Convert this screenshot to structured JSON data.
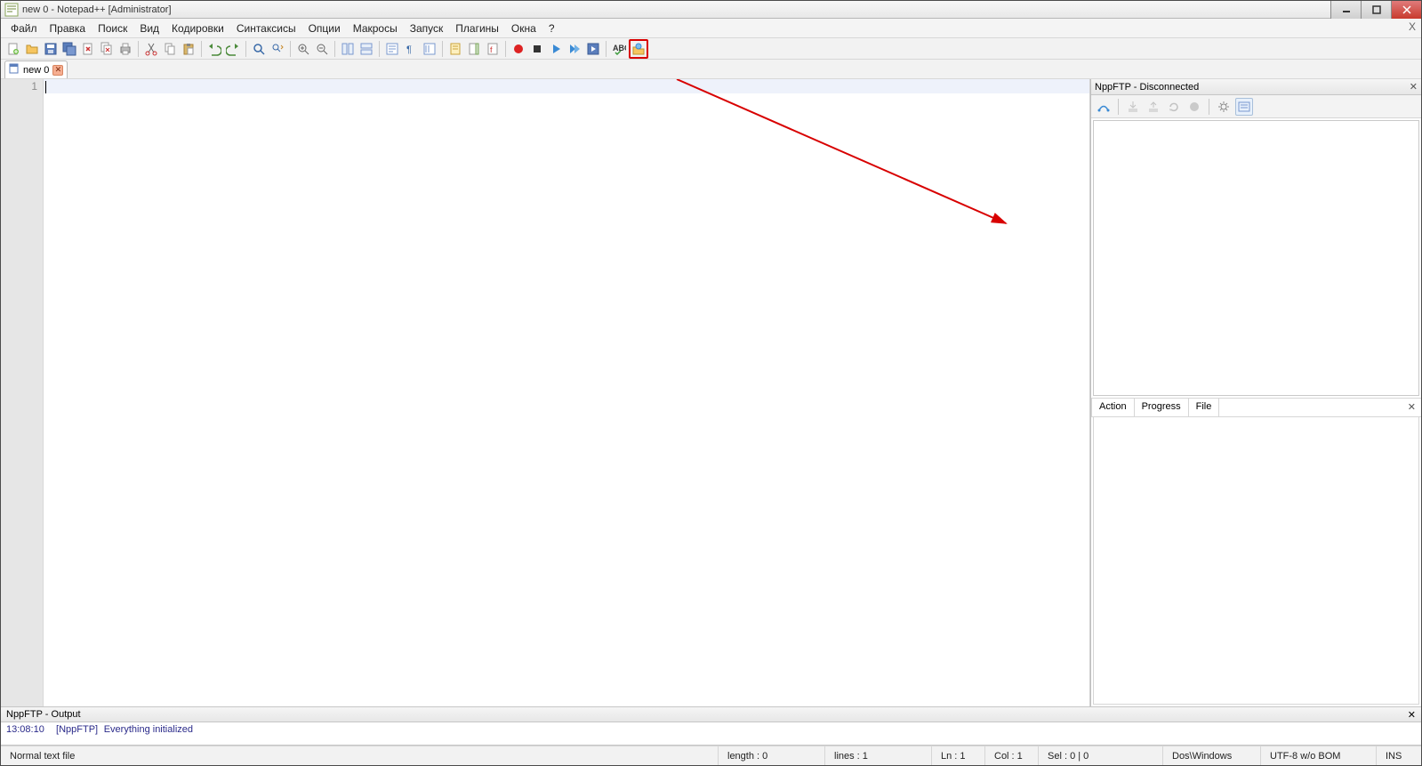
{
  "title": "new  0 - Notepad++ [Administrator]",
  "menu": [
    "Файл",
    "Правка",
    "Поиск",
    "Вид",
    "Кодировки",
    "Синтаксисы",
    "Опции",
    "Макросы",
    "Запуск",
    "Плагины",
    "Окна",
    "?"
  ],
  "tab": {
    "label": "new  0"
  },
  "gutter": {
    "line1": "1"
  },
  "rightpanel": {
    "title": "NppFTP - Disconnected",
    "tabs": [
      "Action",
      "Progress",
      "File"
    ]
  },
  "output": {
    "title": "NppFTP - Output",
    "timestamp": "13:08:10",
    "tag": "[NppFTP]",
    "msg": "Everything initialized"
  },
  "status": {
    "filetype": "Normal text file",
    "length": "length : 0",
    "lines": "lines : 1",
    "ln": "Ln : 1",
    "col": "Col : 1",
    "sel": "Sel : 0 | 0",
    "eol": "Dos\\Windows",
    "enc": "UTF-8 w/o BOM",
    "ins": "INS"
  },
  "icons": {
    "new": "new",
    "open": "open",
    "save": "save",
    "saveall": "saveall",
    "close": "close",
    "closeall": "closeall",
    "print": "print",
    "cut": "cut",
    "copy": "copy",
    "paste": "paste",
    "undo": "undo",
    "redo": "redo",
    "find": "find",
    "replace": "replace",
    "zoomin": "zoomin",
    "zoomout": "zoomout",
    "sync": "sync",
    "wrap": "wrap",
    "allchars": "allchars",
    "indent": "indent",
    "userdef": "userdef",
    "docmap": "docmap",
    "funclist": "funclist",
    "foldermon": "foldermon",
    "record": "record",
    "stop": "stop",
    "play": "play",
    "playmulti": "playmulti",
    "savemacro": "savemacro",
    "spellcheck": "spellcheck",
    "nppftp": "nppftp"
  }
}
